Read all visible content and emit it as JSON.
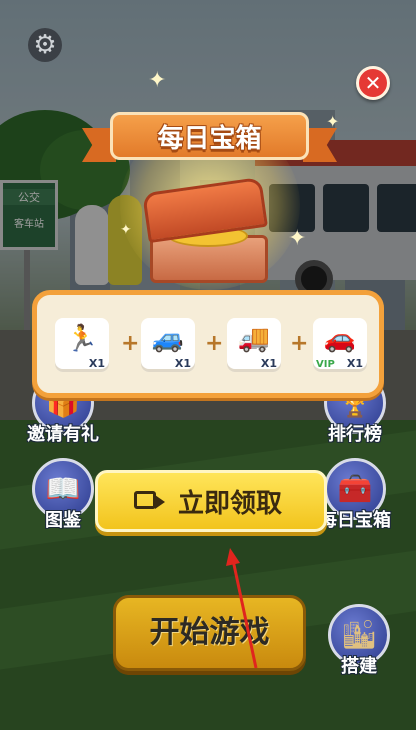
{
  "settings": {
    "icon": "gear-icon",
    "glyph": "⚙"
  },
  "close": {
    "icon": "close-icon",
    "glyph": "✕"
  },
  "scene": {
    "sign_text_1": "公交",
    "sign_text_2": "客车站"
  },
  "popup": {
    "title": "每日宝箱",
    "rewards": [
      {
        "icon": "running-man-speed-icon",
        "glyph": "🏃",
        "qty": "X1"
      },
      {
        "icon": "blue-car-icon",
        "glyph": "🚙",
        "qty": "X1"
      },
      {
        "icon": "truck-icon",
        "glyph": "🚚",
        "qty": "X1"
      },
      {
        "icon": "vip-green-car-icon",
        "glyph": "🚗",
        "qty": "X1",
        "badge": "VIP"
      }
    ],
    "plus": "+",
    "claim_label": "立即领取"
  },
  "menu": {
    "invite": "邀请有礼",
    "leaderboard": "排行榜",
    "gallery": "图鉴",
    "daily_chest": "每日宝箱",
    "start": "开始游戏",
    "build": "搭建"
  },
  "colors": {
    "accent": "#f3a13b",
    "claim": "#f2c41d",
    "start": "#e0a81a",
    "close": "#e53935"
  }
}
